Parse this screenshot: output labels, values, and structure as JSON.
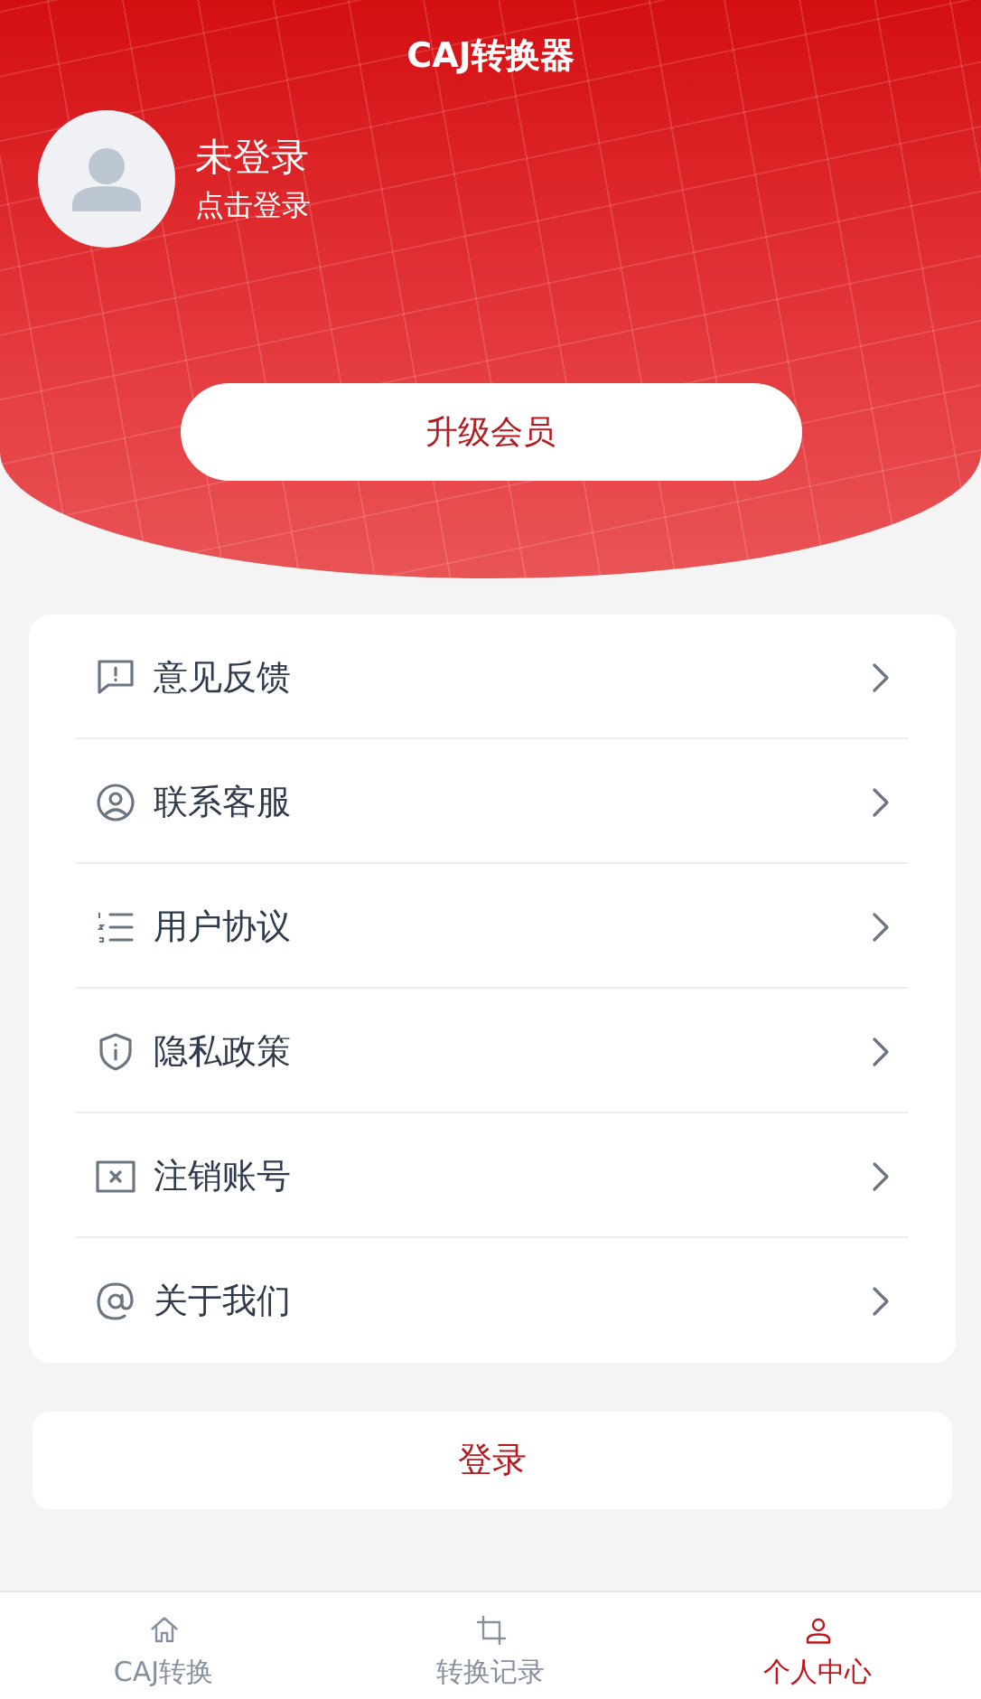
{
  "header": {
    "title": "CAJ转换器"
  },
  "profile": {
    "name": "未登录",
    "hint": "点击登录"
  },
  "upgrade_button": "升级会员",
  "menu": [
    {
      "label": "意见反馈"
    },
    {
      "label": "联系客服"
    },
    {
      "label": "用户协议"
    },
    {
      "label": "隐私政策"
    },
    {
      "label": "注销账号"
    },
    {
      "label": "关于我们"
    }
  ],
  "login_button": "登录",
  "tabs": [
    {
      "label": "CAJ转换",
      "selected": false
    },
    {
      "label": "转换记录",
      "selected": false
    },
    {
      "label": "个人中心",
      "selected": true
    }
  ]
}
